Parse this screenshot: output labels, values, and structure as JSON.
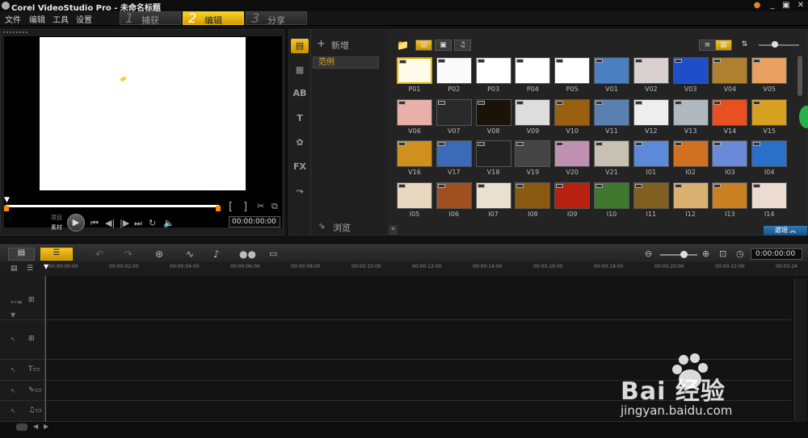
{
  "window": {
    "title": "Corel VideoStudio Pro - 未命名标题"
  },
  "menu": [
    "文件",
    "编辑",
    "工具",
    "设置"
  ],
  "steps": [
    {
      "num": "1",
      "label": "捕获",
      "active": false
    },
    {
      "num": "2",
      "label": "编辑",
      "active": true
    },
    {
      "num": "3",
      "label": "分享",
      "active": false
    }
  ],
  "preview": {
    "mode_labels": [
      "项目",
      "素材"
    ],
    "timecode": "00:00:00:00"
  },
  "library": {
    "add_label": "新增",
    "folder": "范例",
    "browse_label": "浏览",
    "options_label": "選項",
    "thumbs": [
      "P01",
      "P02",
      "P03",
      "P04",
      "P05",
      "V01",
      "V02",
      "V03",
      "V04",
      "V05",
      "V06",
      "V07",
      "V08",
      "V09",
      "V10",
      "V11",
      "V12",
      "V13",
      "V14",
      "V15",
      "V16",
      "V17",
      "V18",
      "V19",
      "V20",
      "V21",
      "I01",
      "I02",
      "I03",
      "I04",
      "I05",
      "I06",
      "I07",
      "I08",
      "I09",
      "I10",
      "I11",
      "I12",
      "I13",
      "I14"
    ],
    "thumb_colors": [
      "#fffbe8",
      "#fafafa",
      "#ffffff",
      "#ffffff",
      "#ffffff",
      "#4a7fc0",
      "#d8d0cc",
      "#1f4ec9",
      "#b08030",
      "#e8a060",
      "#e8b0a8",
      "#2a2a2a",
      "#1a1408",
      "#dddddd",
      "#9a6010",
      "#5a80b0",
      "#eeeeee",
      "#b0b8c0",
      "#e85020",
      "#d8a020",
      "#d09020",
      "#3a6ab8",
      "#222222",
      "#444444",
      "#c090b0",
      "#c8c0b0",
      "#5a8ad8",
      "#d07020",
      "#6a8ad8",
      "#2a70c8",
      "#e8d8c0",
      "#a05020",
      "#e8e0d0",
      "#8a5a10",
      "#b82010",
      "#407830",
      "#806020",
      "#d8b070",
      "#c88020",
      "#ecdcd0"
    ]
  },
  "timeline": {
    "ruler": [
      "00:00:00:00",
      "00:00:02:00",
      "00:00:04:00",
      "00:00:06:00",
      "00:00:08:00",
      "00:00:10:00",
      "00:00:12:00",
      "00:00:14:00",
      "00:00:16:00",
      "00:00:18:00",
      "00:00:20:00",
      "00:00:22:00",
      "00:00:24"
    ],
    "timecode": "0:00:00:00"
  },
  "watermark": {
    "brand": "Bai  经验",
    "url": "jingyan.baidu.com"
  }
}
